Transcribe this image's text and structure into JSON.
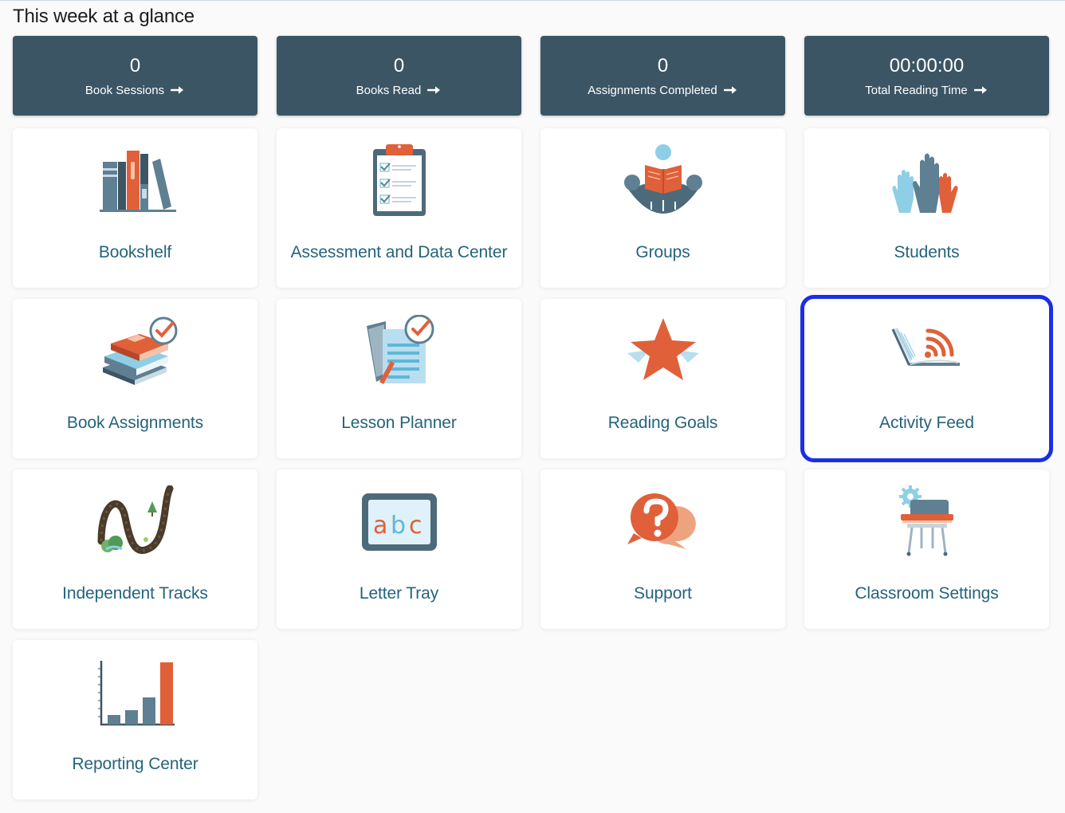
{
  "header": {
    "title": "This week at a glance"
  },
  "stats": [
    {
      "value": "0",
      "label": "Book Sessions"
    },
    {
      "value": "0",
      "label": "Books Read"
    },
    {
      "value": "0",
      "label": "Assignments Completed"
    },
    {
      "value": "00:00:00",
      "label": "Total Reading Time"
    }
  ],
  "tiles": [
    {
      "label": "Bookshelf",
      "icon": "bookshelf-icon"
    },
    {
      "label": "Assessment and Data Center",
      "icon": "clipboard-checklist-icon"
    },
    {
      "label": "Groups",
      "icon": "group-reading-icon"
    },
    {
      "label": "Students",
      "icon": "raised-hands-icon"
    },
    {
      "label": "Book Assignments",
      "icon": "book-stack-check-icon"
    },
    {
      "label": "Lesson Planner",
      "icon": "lesson-plan-check-icon"
    },
    {
      "label": "Reading Goals",
      "icon": "star-icon"
    },
    {
      "label": "Activity Feed",
      "icon": "book-feed-icon"
    },
    {
      "label": "Independent Tracks",
      "icon": "winding-path-icon"
    },
    {
      "label": "Letter Tray",
      "icon": "abc-board-icon"
    },
    {
      "label": "Support",
      "icon": "question-bubbles-icon"
    },
    {
      "label": "Classroom Settings",
      "icon": "desk-gear-icon"
    },
    {
      "label": "Reporting Center",
      "icon": "bar-chart-icon"
    }
  ],
  "focused_tile": "Activity Feed",
  "colors": {
    "stat_background": "#3b5564",
    "tile_label": "#24637c",
    "focus_outline": "#1a2ee8",
    "accent_orange": "#e0603a",
    "slate": "#5f7f92",
    "light_blue": "#8ecfe6"
  }
}
